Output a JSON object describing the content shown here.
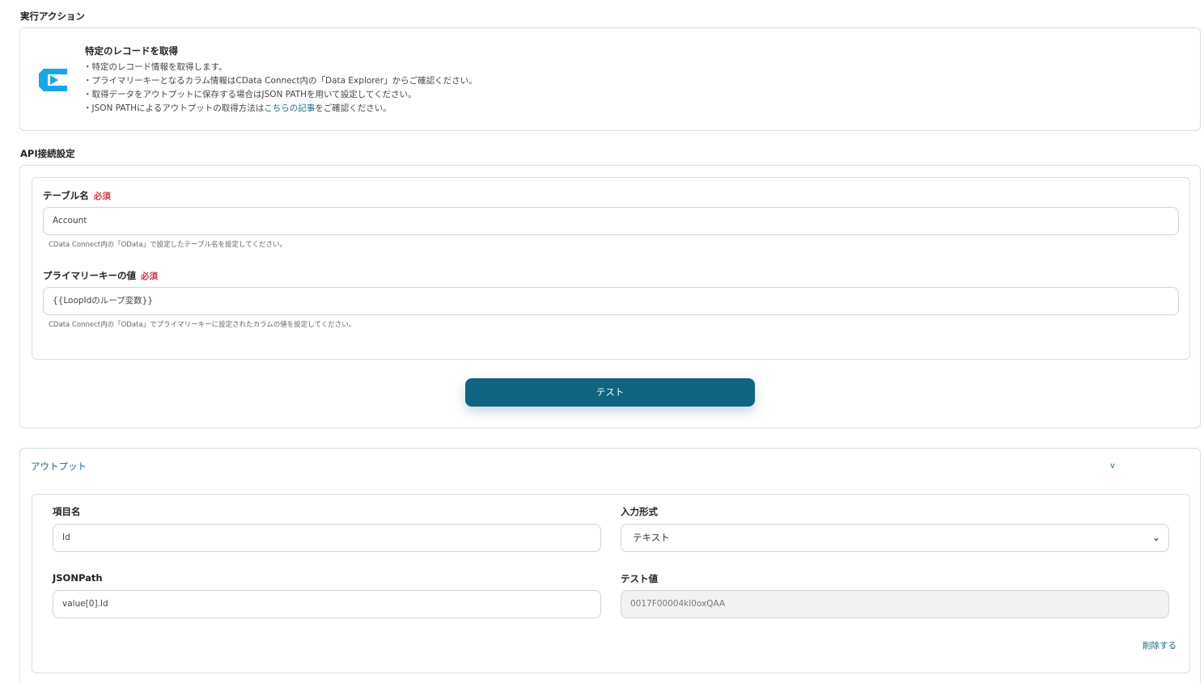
{
  "sections": {
    "action_title": "実行アクション",
    "api_title": "API接続設定"
  },
  "action": {
    "title": "特定のレコードを取得",
    "desc1": "・特定のレコード情報を取得します。",
    "desc2": "・プライマリーキーとなるカラム情報はCData Connect内の「Data Explorer」からご確認ください。",
    "desc3": "・取得データをアウトプットに保存する場合はJSON PATHを用いて設定してください。",
    "desc4_prefix": "・JSON PATHによるアウトプットの取得方法は",
    "desc4_link": "こちらの記事",
    "desc4_suffix": "をご確認ください。",
    "logo_icon": "cdata-logo-icon",
    "logo_color": "#1aa6e4"
  },
  "api": {
    "table_label": "テーブル名",
    "required_label": "必須",
    "table_value": "Account",
    "table_help": "CData Connect内の「OData」で設定したテーブル名を設定してください。",
    "pk_label": "プライマリーキーの値",
    "pk_value": "{{LoopIdのループ変数}}",
    "pk_help": "CData Connect内の「OData」でプライマリーキーに設定されたカラムの値を設定してください。",
    "test_button": "テスト"
  },
  "output": {
    "title": "アウトプット",
    "toggle": "v",
    "item_name_label": "項目名",
    "item_name_value": "Id",
    "input_format_label": "入力形式",
    "input_format_value": "テキスト",
    "jsonpath_label": "JSONPath",
    "jsonpath_value": "value[0].Id",
    "test_value_label": "テスト値",
    "test_value": "0017F00004kl0oxQAA",
    "delete_link": "削除する"
  },
  "colors": {
    "accent": "#0f6580",
    "link": "#1a6b84",
    "required": "#d0364b",
    "border": "#d9dde2"
  }
}
